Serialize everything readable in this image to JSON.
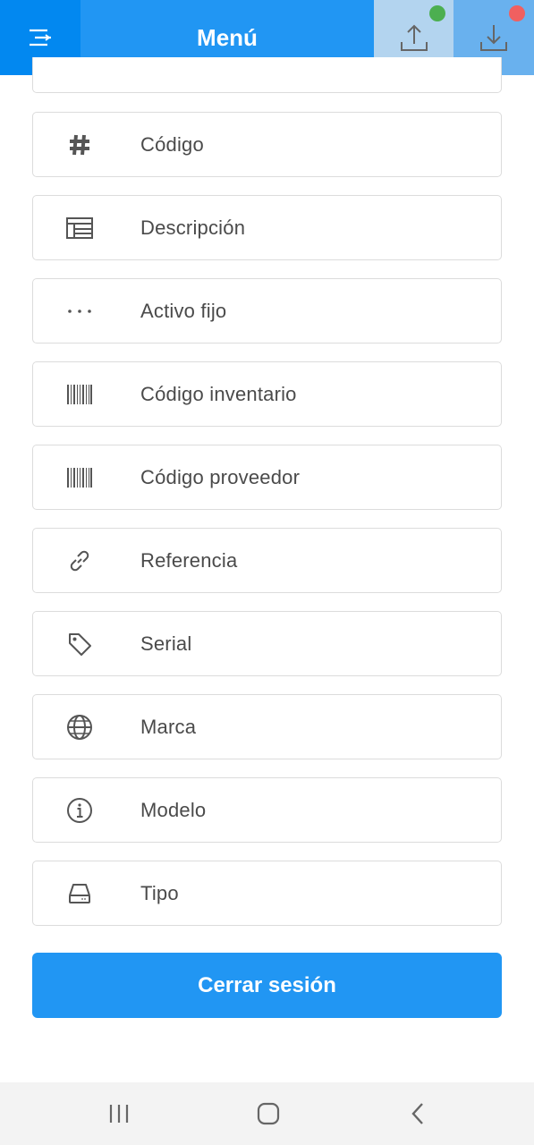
{
  "header": {
    "title": "Menú",
    "menu_icon": "menu-icon",
    "upload_icon": "upload-icon",
    "download_icon": "download-icon",
    "upload_status_color": "#4caf50",
    "download_status_color": "#f06060"
  },
  "items": [
    {
      "label": "Código",
      "icon": "hash-icon"
    },
    {
      "label": "Descripción",
      "icon": "description-icon"
    },
    {
      "label": "Activo fijo",
      "icon": "ellipsis-icon"
    },
    {
      "label": "Código inventario",
      "icon": "barcode-icon"
    },
    {
      "label": "Código proveedor",
      "icon": "barcode-icon"
    },
    {
      "label": "Referencia",
      "icon": "link-icon"
    },
    {
      "label": "Serial",
      "icon": "tag-icon"
    },
    {
      "label": "Marca",
      "icon": "globe-icon"
    },
    {
      "label": "Modelo",
      "icon": "info-icon"
    },
    {
      "label": "Tipo",
      "icon": "drive-icon"
    }
  ],
  "logout": {
    "label": "Cerrar sesión"
  },
  "colors": {
    "primary": "#2196f3",
    "text": "#4a4a4a",
    "border": "#dcdcdc"
  },
  "navbar": {
    "recents_icon": "recents-icon",
    "home_icon": "home-icon",
    "back_icon": "back-icon"
  }
}
